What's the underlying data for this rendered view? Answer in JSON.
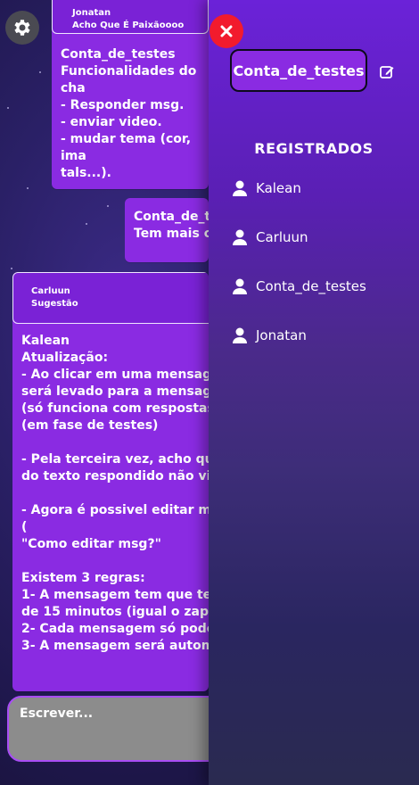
{
  "chat": {
    "messages": [
      {
        "reply_author": "Jonatan",
        "reply_text": "Acho Que É Paixãoooo",
        "author": "Conta_de_testes",
        "text": "Funcionalidades do cha\n- Responder msg.\n- enviar video.\n- mudar tema (cor, ima\ntals...)."
      },
      {
        "author": "Conta_de_te",
        "text": "Tem mais co"
      },
      {
        "reply_author": "Carluun",
        "reply_text": "Sugestão",
        "author": "Kalean",
        "text": "Atualização:\n- Ao clicar em uma mensagem\nserá levado para a mensagem\n(só funciona com respostas n\n(em fase de testes)\n\n- Pela terceira vez, acho que n\ndo texto respondido não vir n\n\n- Agora é possivel editar msg\n(\n\"Como editar msg?\"\n\nExistem 3 regras:\n1- A mensagem tem que ter s\nde 15 minutos (igual o zap).\n2- Cada mensagem só pode s\n3- A mensagem será automat"
      }
    ]
  },
  "composer": {
    "placeholder": "Escrever..."
  },
  "sidebar": {
    "current_user": "Conta_de_testes",
    "section_title": "REGISTRADOS",
    "users": [
      "Kalean",
      "Carluun",
      "Conta_de_testes",
      "Jonatan"
    ]
  },
  "icons": {
    "settings": "gear-icon",
    "close": "close-icon",
    "edit": "edit-icon",
    "user": "user-icon"
  },
  "colors": {
    "bubble": "#8a2be2",
    "close": "#f21b2d",
    "settings": "#4a4a52",
    "composer": "#8c8c8c"
  }
}
